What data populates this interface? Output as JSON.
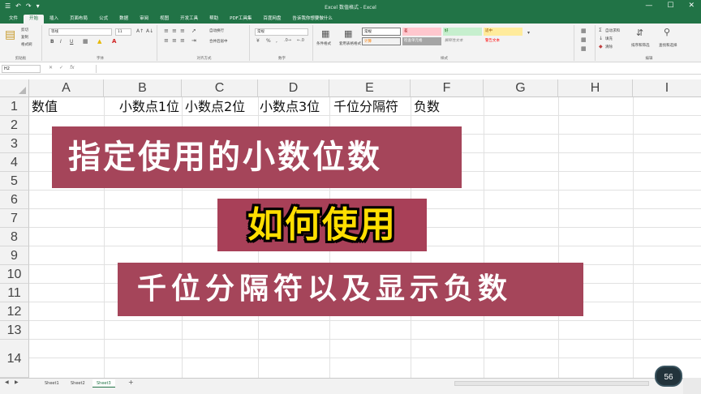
{
  "app": {
    "title": "Excel 数值格式 - Excel",
    "quick_access": [
      "☰",
      "↶",
      "↷",
      "▾"
    ],
    "window_controls": [
      "—",
      "☐",
      "✕"
    ]
  },
  "ribbon": {
    "tabs": [
      "文件",
      "开始",
      "插入",
      "页面布局",
      "公式",
      "数据",
      "审阅",
      "视图",
      "开发工具",
      "帮助",
      "PDF工具集",
      "百度网盘",
      "告诉我你想要做什么"
    ],
    "active_tab": "开始",
    "clipboard": {
      "cut": "剪切",
      "copy": "复制",
      "painter": "格式刷",
      "label": "剪贴板"
    },
    "font": {
      "family": "等线",
      "size": "11",
      "label": "字体",
      "buttons": [
        "B",
        "I",
        "U"
      ]
    },
    "alignment": {
      "wrap": "自动换行",
      "merge": "合并后居中",
      "label": "对齐方式"
    },
    "number": {
      "format": "常规",
      "label": "数字"
    },
    "styles": {
      "conditional": "条件格式",
      "table": "套用表格格式",
      "chips": [
        "常规",
        "差",
        "好",
        "适中",
        "计算",
        "检查单元格",
        "解释性文本",
        "警告文本"
      ],
      "label": "样式"
    },
    "cells": {
      "insert": "插入",
      "delete": "删除",
      "format": "格式",
      "label": "单元格"
    },
    "editing": {
      "autosum": "自动求和",
      "fill": "填充",
      "clear": "清除",
      "sort": "排序和筛选",
      "find": "查找和选择",
      "label": "编辑"
    }
  },
  "formula_bar": {
    "name_box": "H2",
    "fx": "fx",
    "cancel": "✕",
    "enter": "✓",
    "value": ""
  },
  "grid": {
    "columns": [
      "A",
      "B",
      "C",
      "D",
      "E",
      "F",
      "G",
      "H",
      "I"
    ],
    "rows": [
      "1",
      "2",
      "3",
      "4",
      "5",
      "6",
      "7",
      "8",
      "9",
      "10",
      "11",
      "12",
      "13",
      "14"
    ],
    "row1": {
      "A": "数值",
      "B": "小数点1位",
      "C": "小数点2位",
      "D": "小数点3位",
      "E": "千位分隔符",
      "F": "负数"
    }
  },
  "overlays": {
    "banner1": "指定使用的小数位数",
    "banner2": "如何使用",
    "banner3": "千位分隔符以及显示负数"
  },
  "sheets": {
    "tabs": [
      "Sheet1",
      "Sheet2",
      "Sheet3"
    ],
    "active": "Sheet3",
    "add": "+"
  },
  "badge": {
    "speed": "56"
  },
  "colors": {
    "excel_green": "#217346",
    "banner_red": "#a5455a",
    "title_yellow": "#ffde00"
  }
}
